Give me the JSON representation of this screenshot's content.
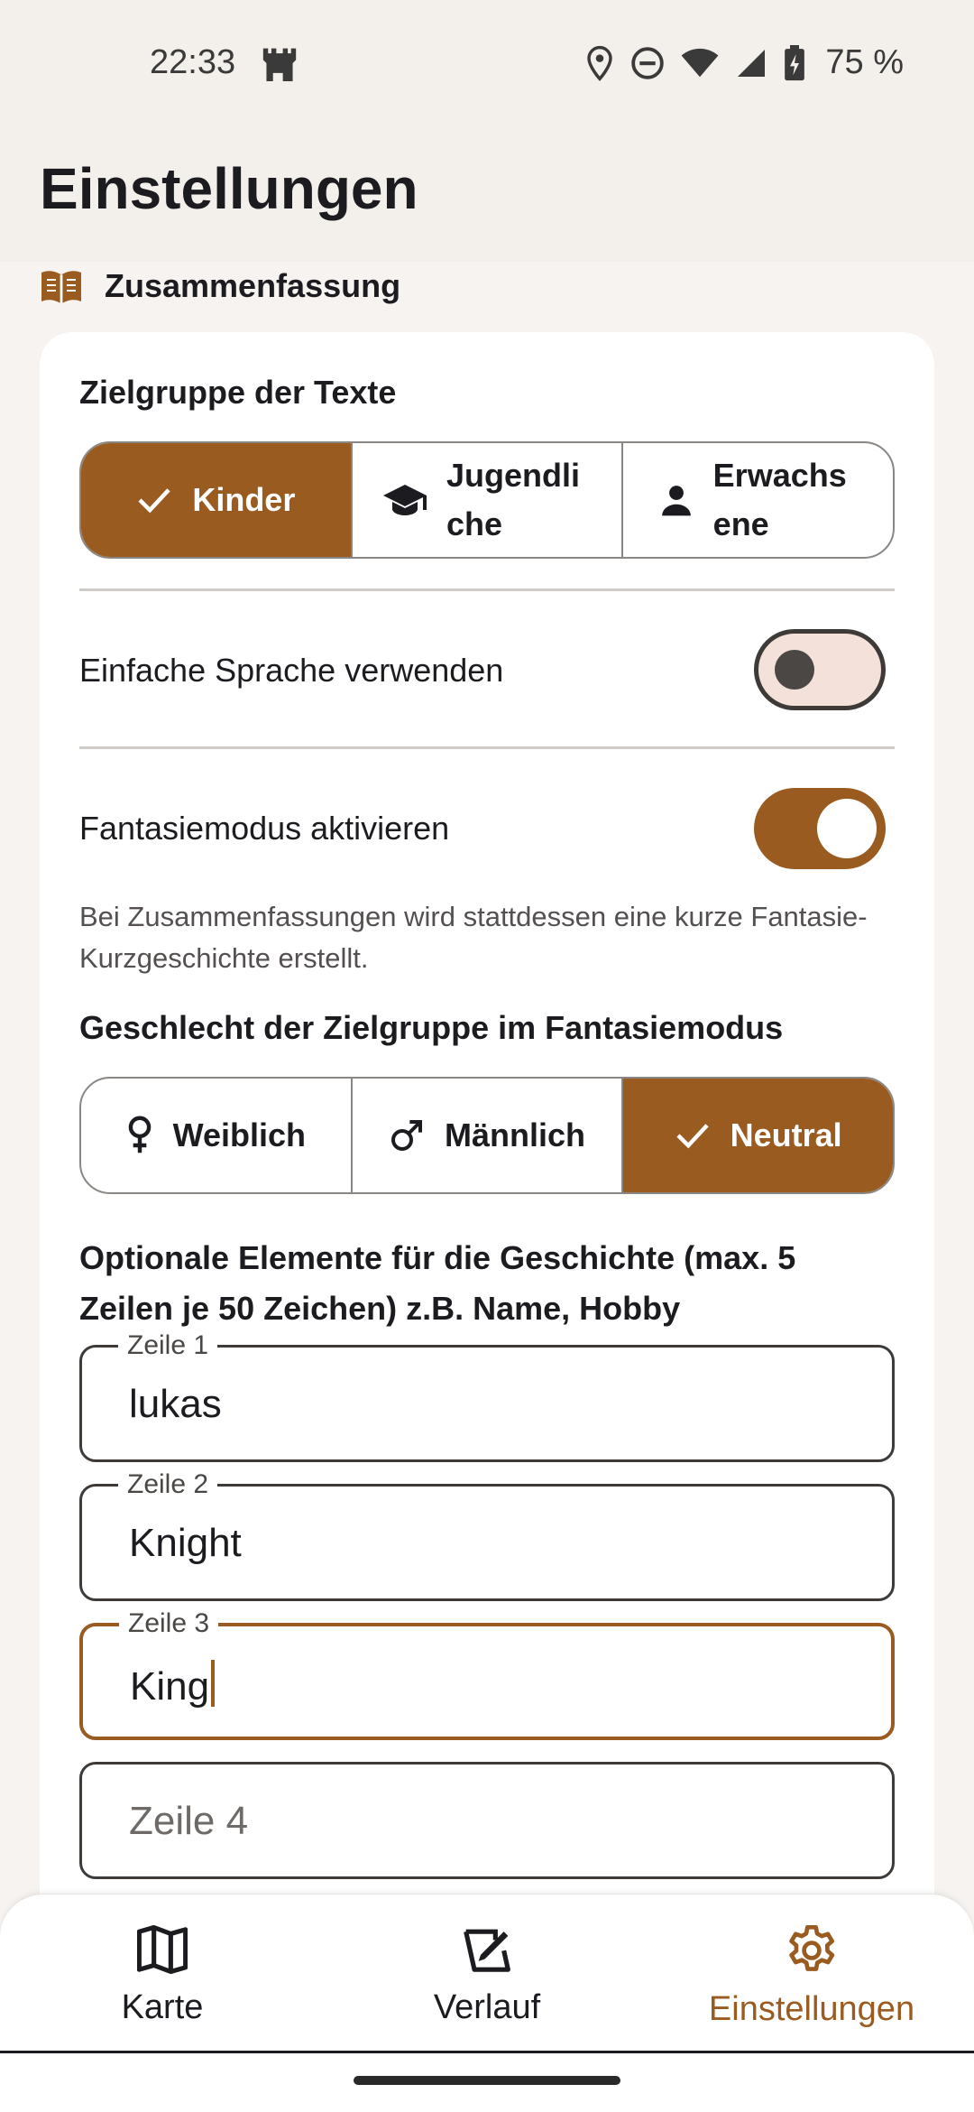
{
  "status_bar": {
    "time": "22:33",
    "battery": "75 %"
  },
  "app": {
    "title": "Einstellungen"
  },
  "section": {
    "label": "Zusammenfassung"
  },
  "audience": {
    "label": "Zielgruppe der Texte",
    "options": [
      {
        "label": "Kinder",
        "selected": true
      },
      {
        "label": "Jugendliche",
        "selected": false
      },
      {
        "label": "Erwachsene",
        "selected": false
      }
    ]
  },
  "simple_language": {
    "label": "Einfache Sprache verwenden",
    "enabled": false
  },
  "fantasy_mode": {
    "label": "Fantasiemodus aktivieren",
    "enabled": true,
    "helper": "Bei Zusammenfassungen wird stattdessen eine kurze Fantasie-Kurzgeschichte erstellt."
  },
  "gender": {
    "label": "Geschlecht der Zielgruppe im Fantasiemodus",
    "options": [
      {
        "label": "Weiblich",
        "selected": false
      },
      {
        "label": "Männlich",
        "selected": false
      },
      {
        "label": "Neutral",
        "selected": true
      }
    ]
  },
  "elements": {
    "label": "Optionale Elemente für die Geschichte (max. 5 Zeilen je 50 Zeichen) z.B. Name, Hobby",
    "fields": [
      {
        "label": "Zeile 1",
        "value": "lukas"
      },
      {
        "label": "Zeile 2",
        "value": "Knight"
      },
      {
        "label": "Zeile 3",
        "value": "King"
      },
      {
        "placeholder": "Zeile 4",
        "value": ""
      }
    ]
  },
  "nav": {
    "items": [
      {
        "label": "Karte",
        "icon": "map-icon"
      },
      {
        "label": "Verlauf",
        "icon": "history-icon"
      },
      {
        "label": "Einstellungen",
        "icon": "settings-icon",
        "active": true
      }
    ]
  },
  "colors": {
    "accent": "#9a5b20",
    "background": "#f6f3f0",
    "card": "#ffffff"
  }
}
